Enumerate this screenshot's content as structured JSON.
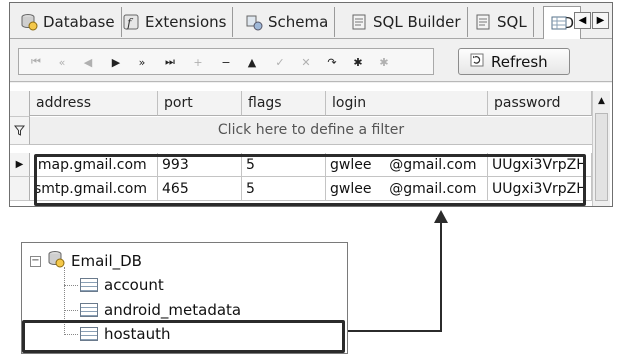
{
  "tabs": [
    {
      "label": "Database",
      "icon": "database-icon",
      "active": false
    },
    {
      "label": "Extensions",
      "icon": "extensions-icon",
      "active": false
    },
    {
      "label": "Schema",
      "icon": "schema-icon",
      "active": false
    },
    {
      "label": "SQL Builder",
      "icon": "sql-builder-icon",
      "active": false
    },
    {
      "label": "SQL",
      "icon": "sql-icon",
      "active": false
    },
    {
      "label": "D",
      "icon": "data-icon",
      "active": true
    }
  ],
  "tab_scroll": {
    "left": "◀",
    "right": "▶"
  },
  "navigator": {
    "buttons": [
      {
        "name": "first-record-button",
        "glyph": "⏮",
        "enabled": false
      },
      {
        "name": "prior-page-button",
        "glyph": "«",
        "enabled": false
      },
      {
        "name": "prior-record-button",
        "glyph": "◀",
        "enabled": false
      },
      {
        "name": "next-record-button",
        "glyph": "▶",
        "enabled": true
      },
      {
        "name": "next-page-button",
        "glyph": "»",
        "enabled": true
      },
      {
        "name": "last-record-button",
        "glyph": "⏭",
        "enabled": true
      },
      {
        "name": "insert-record-button",
        "glyph": "+",
        "enabled": false
      },
      {
        "name": "delete-record-button",
        "glyph": "−",
        "enabled": true
      },
      {
        "name": "edit-record-button",
        "glyph": "▲",
        "enabled": true
      },
      {
        "name": "post-edit-button",
        "glyph": "✓",
        "enabled": false
      },
      {
        "name": "cancel-edit-button",
        "glyph": "✕",
        "enabled": false
      },
      {
        "name": "refresh-records-button",
        "glyph": "↷",
        "enabled": true
      },
      {
        "name": "apply-filter-button",
        "glyph": "✱",
        "enabled": true
      },
      {
        "name": "clear-filter-button",
        "glyph": "✱",
        "enabled": false
      }
    ],
    "refresh_label": "Refresh"
  },
  "grid": {
    "columns": [
      "address",
      "port",
      "flags",
      "login",
      "password"
    ],
    "filter_placeholder": "Click here to define a filter",
    "rows": [
      {
        "address": "imap.gmail.com",
        "port": "993",
        "flags": "5",
        "login": "gwlee    @gmail.com",
        "password": "UUgxi3VrpZH"
      },
      {
        "address": "smtp.gmail.com",
        "port": "465",
        "flags": "5",
        "login": "gwlee    @gmail.com",
        "password": "UUgxi3VrpZH"
      }
    ]
  },
  "tree": {
    "root": "Email_DB",
    "tables": [
      "account",
      "android_metadata",
      "hostauth"
    ],
    "selected": "hostauth"
  },
  "colors": {
    "highlight": "#2b2b2b",
    "tab_bg": "#f0f0f0"
  }
}
